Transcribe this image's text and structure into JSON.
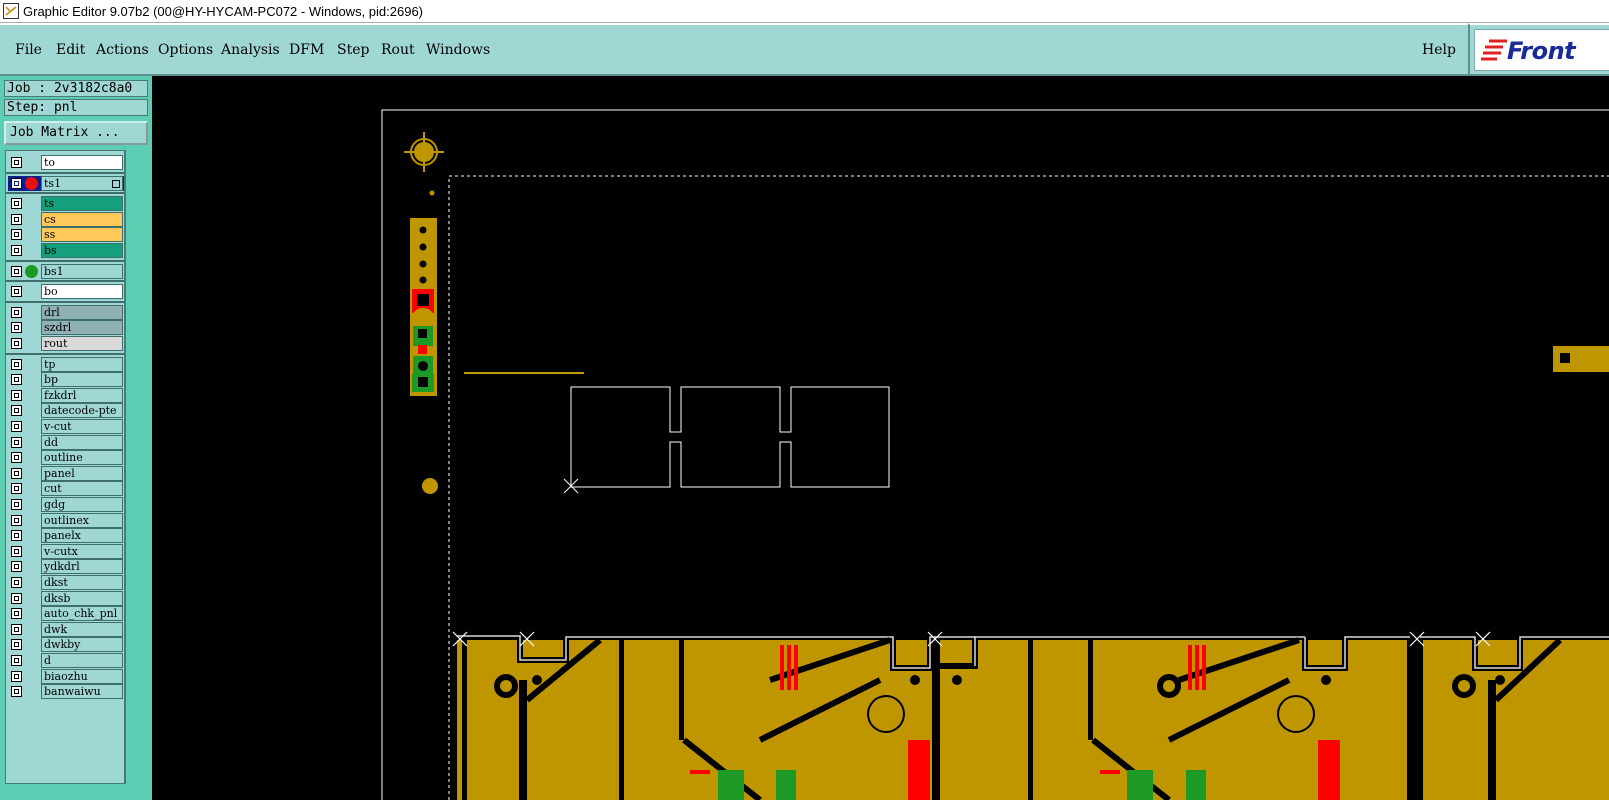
{
  "window": {
    "title": "Graphic Editor 9.07b2 (00@HY-HYCAM-PC072 - Windows, pid:2696)"
  },
  "menu": {
    "items": [
      "File",
      "Edit",
      "Actions",
      "Options",
      "Analysis",
      "DFM",
      "Step",
      "Rout",
      "Windows"
    ],
    "help": "Help"
  },
  "logo": {
    "text": "Front"
  },
  "job": {
    "label": "Job : 2v3182c8a0",
    "step": "Step: pnl"
  },
  "job_matrix_button": "Job Matrix ...",
  "layers": [
    {
      "name": "to",
      "color": "#ffffff",
      "dot": null
    },
    {
      "name": "ts1",
      "color": "#9fd7d5",
      "dot": "#e81010",
      "active": true
    },
    {
      "name": "ts",
      "color": "#13a07a",
      "dot": null
    },
    {
      "name": "cs",
      "color": "#ffc85a",
      "dot": null
    },
    {
      "name": "ss",
      "color": "#ffc85a",
      "dot": null
    },
    {
      "name": "bs",
      "color": "#13a07a",
      "dot": null
    },
    {
      "name": "bs1",
      "color": "#9fd7d5",
      "dot": "#1d9a25"
    },
    {
      "name": "bo",
      "color": "#ffffff",
      "dot": null
    },
    {
      "name": "drl",
      "color": "#8fb0b4",
      "dot": null
    },
    {
      "name": "szdrl",
      "color": "#8fb0b4",
      "dot": null
    },
    {
      "name": "rout",
      "color": "#d9d9d9",
      "dot": null
    },
    {
      "name": "tp",
      "color": "#9fd7d5",
      "dot": null
    },
    {
      "name": "bp",
      "color": "#9fd7d5",
      "dot": null
    },
    {
      "name": "fzkdrl",
      "color": "#9fd7d5",
      "dot": null
    },
    {
      "name": "datecode-pte",
      "color": "#9fd7d5",
      "dot": null
    },
    {
      "name": "v-cut",
      "color": "#9fd7d5",
      "dot": null
    },
    {
      "name": "dd",
      "color": "#9fd7d5",
      "dot": null
    },
    {
      "name": "outline",
      "color": "#9fd7d5",
      "dot": null
    },
    {
      "name": "panel",
      "color": "#9fd7d5",
      "dot": null
    },
    {
      "name": "cut",
      "color": "#9fd7d5",
      "dot": null
    },
    {
      "name": "gdg",
      "color": "#9fd7d5",
      "dot": null
    },
    {
      "name": "outlinex",
      "color": "#9fd7d5",
      "dot": null
    },
    {
      "name": "panelx",
      "color": "#9fd7d5",
      "dot": null
    },
    {
      "name": "v-cutx",
      "color": "#9fd7d5",
      "dot": null
    },
    {
      "name": "ydkdrl",
      "color": "#9fd7d5",
      "dot": null
    },
    {
      "name": "dkst",
      "color": "#9fd7d5",
      "dot": null
    },
    {
      "name": "dksb",
      "color": "#9fd7d5",
      "dot": null
    },
    {
      "name": "auto_chk_pnl",
      "color": "#9fd7d5",
      "dot": null
    },
    {
      "name": "dwk",
      "color": "#9fd7d5",
      "dot": null
    },
    {
      "name": "dwkby",
      "color": "#9fd7d5",
      "dot": null
    },
    {
      "name": "d",
      "color": "#9fd7d5",
      "dot": null
    },
    {
      "name": "biaozhu",
      "color": "#9fd7d5",
      "dot": null
    },
    {
      "name": "banwaiwu",
      "color": "#9fd7d5",
      "dot": null
    }
  ],
  "colors": {
    "copper": "#bf9600",
    "outline": "#ffffff",
    "mask_red": "#ff0000",
    "mask_green": "#1d9a25",
    "menu_bg": "#9fd7d5",
    "panel_bg": "#5dcdb3"
  }
}
